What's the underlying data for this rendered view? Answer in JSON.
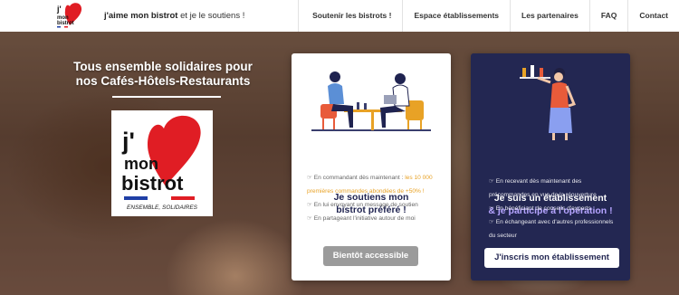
{
  "header": {
    "logo_lines": [
      "j'",
      "mon",
      "bistrot"
    ],
    "tagline_strong": "j'aime mon bistrot",
    "tagline_rest": " et je le soutiens !"
  },
  "nav": {
    "items": [
      {
        "label": "Soutenir les bistrots !"
      },
      {
        "label": "Espace établissements"
      },
      {
        "label": "Les partenaires"
      },
      {
        "label": "FAQ"
      },
      {
        "label": "Contact"
      }
    ]
  },
  "hero": {
    "title_line1": "Tous ensemble solidaires pour",
    "title_line2": "nos Cafés-Hôtels-Restaurants",
    "logo": {
      "line1": "j'",
      "line2": "mon",
      "line3": "bistrot",
      "subtitle": "ENSEMBLE, SOLIDAIRES"
    }
  },
  "customer_card": {
    "title_line1": "Je soutiens mon",
    "title_line2": "bistrot préféré !",
    "items": [
      {
        "lead": "En commandant dès maintenant : ",
        "highlight": "les 10 000 premières commandes abondées de +50% !"
      },
      {
        "lead": "En lui envoyant un message de soutien",
        "highlight": ""
      },
      {
        "lead": "En partageant l'initiative autour de moi",
        "highlight": ""
      }
    ],
    "button_label": "Bientôt accessible"
  },
  "business_card": {
    "title_line1": "Je suis un établissement",
    "title_line2": "& je participe à l'opération !",
    "items": [
      {
        "text": "En recevant dès maintenant des précommandes en vue de la réouverture"
      },
      {
        "text": "En bénéficiant de conseils d'experts"
      },
      {
        "text": "En échangeant avec d'autres professionnels du secteur"
      }
    ],
    "button_label": "J'inscris mon établissement"
  },
  "colors": {
    "navy": "#232752",
    "accent_purple": "#b5a4ff",
    "highlight_orange": "#e8a226",
    "logo_red": "#e01d24",
    "grey_button": "#9b9b9b"
  },
  "icons": {
    "list_bullet": "hand-pointing-icon"
  }
}
